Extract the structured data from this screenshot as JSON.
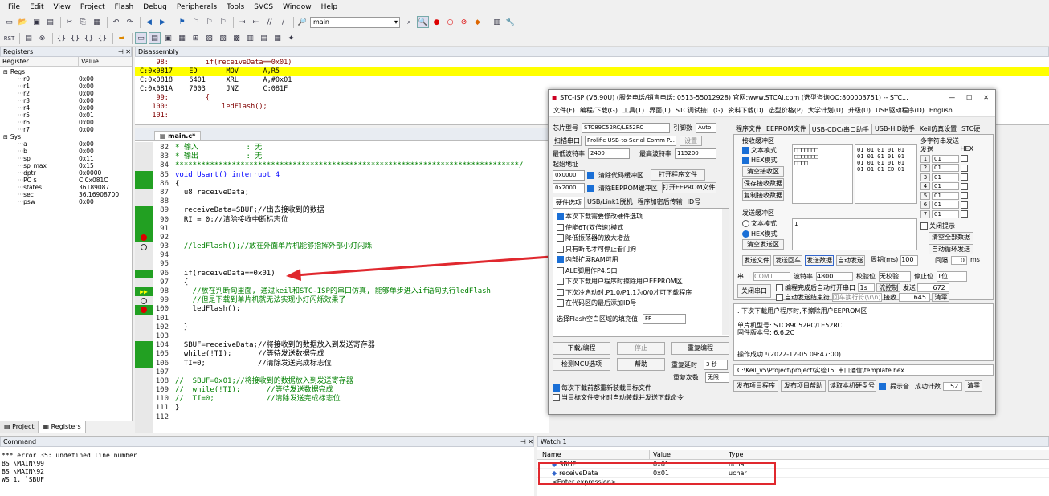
{
  "menu": [
    "File",
    "Edit",
    "View",
    "Project",
    "Flash",
    "Debug",
    "Peripherals",
    "Tools",
    "SVCS",
    "Window",
    "Help"
  ],
  "toolbar": {
    "target": "main"
  },
  "registers": {
    "title": "Registers",
    "col_register": "Register",
    "col_value": "Value",
    "rows": [
      {
        "name": "Regs",
        "value": "",
        "indent": 0
      },
      {
        "name": "r0",
        "value": "0x00",
        "indent": 1
      },
      {
        "name": "r1",
        "value": "0x00",
        "indent": 1
      },
      {
        "name": "r2",
        "value": "0x00",
        "indent": 1
      },
      {
        "name": "r3",
        "value": "0x00",
        "indent": 1
      },
      {
        "name": "r4",
        "value": "0x00",
        "indent": 1
      },
      {
        "name": "r5",
        "value": "0x01",
        "indent": 1
      },
      {
        "name": "r6",
        "value": "0x00",
        "indent": 1
      },
      {
        "name": "r7",
        "value": "0x00",
        "indent": 1
      },
      {
        "name": "Sys",
        "value": "",
        "indent": 0
      },
      {
        "name": "a",
        "value": "0x00",
        "indent": 1
      },
      {
        "name": "b",
        "value": "0x00",
        "indent": 1
      },
      {
        "name": "sp",
        "value": "0x11",
        "indent": 1
      },
      {
        "name": "sp_max",
        "value": "0x15",
        "indent": 1
      },
      {
        "name": "dptr",
        "value": "0x0000",
        "indent": 1
      },
      {
        "name": "PC  $",
        "value": "C:0x081C",
        "indent": 1
      },
      {
        "name": "states",
        "value": "36189087",
        "indent": 1
      },
      {
        "name": "sec",
        "value": "36.16908700",
        "indent": 1
      },
      {
        "name": "psw",
        "value": "0x00",
        "indent": 1
      }
    ],
    "tabs": [
      "Project",
      "Registers"
    ]
  },
  "disassembly": {
    "title": "Disassembly",
    "lines": [
      {
        "text": "    98:         if(receiveData==0x01)",
        "hl": false
      },
      {
        "text": "C:0x0817    ED       MOV      A,R5",
        "hl": true
      },
      {
        "text": "C:0x0818    6401     XRL      A,#0x01",
        "hl": false
      },
      {
        "text": "C:0x081A    7003     JNZ      C:081F",
        "hl": false
      },
      {
        "text": "    99:         {",
        "hl": false
      },
      {
        "text": "   100:             ledFlash();",
        "hl": false
      },
      {
        "text": "   101:",
        "hl": false
      }
    ]
  },
  "editor": {
    "tab": "main.c*",
    "lines": [
      {
        "n": "82",
        "t": "* 输入           : 无",
        "c": "cm"
      },
      {
        "n": "83",
        "t": "* 输出           : 无",
        "c": "cm"
      },
      {
        "n": "84",
        "t": "*******************************************************************************/",
        "c": "cm"
      },
      {
        "n": "85",
        "t": "void Usart() interrupt 4",
        "c": "kw"
      },
      {
        "n": "86",
        "t": "{",
        "c": ""
      },
      {
        "n": "87",
        "t": "  u8 receiveData;",
        "c": ""
      },
      {
        "n": "88",
        "t": "",
        "c": ""
      },
      {
        "n": "89",
        "t": "  receiveData=SBUF;//出去接收到的数据",
        "c": "mix"
      },
      {
        "n": "90",
        "t": "  RI = 0;//清除接收中断标志位",
        "c": "mix"
      },
      {
        "n": "91",
        "t": "",
        "c": ""
      },
      {
        "n": "92",
        "t": "",
        "c": ""
      },
      {
        "n": "93",
        "t": "  //ledFlash();//放在外面单片机能够指挥外部小灯闪烁",
        "c": "cm"
      },
      {
        "n": "94",
        "t": "",
        "c": ""
      },
      {
        "n": "95",
        "t": "",
        "c": ""
      },
      {
        "n": "96",
        "t": "  if(receiveData==0x01)",
        "c": ""
      },
      {
        "n": "97",
        "t": "  {",
        "c": ""
      },
      {
        "n": "98",
        "t": "    //放在判断句里面, 通过keil和STC-ISP的串口仿真, 能够单步进入if语句执行ledFlash",
        "c": "cm"
      },
      {
        "n": "99",
        "t": "    //但是下载到单片机就无法实现小灯闪烁效果了",
        "c": "cm"
      },
      {
        "n": "100",
        "t": "    ledFlash();",
        "c": ""
      },
      {
        "n": "101",
        "t": "",
        "c": ""
      },
      {
        "n": "102",
        "t": "  }",
        "c": ""
      },
      {
        "n": "103",
        "t": "",
        "c": ""
      },
      {
        "n": "104",
        "t": "  SBUF=receiveData;//将接收到的数据放入到发送寄存器",
        "c": "mix"
      },
      {
        "n": "105",
        "t": "  while(!TI);      //等待发送数据完成",
        "c": "mix"
      },
      {
        "n": "106",
        "t": "  TI=0;            //清除发送完成标志位",
        "c": "mix"
      },
      {
        "n": "107",
        "t": "",
        "c": ""
      },
      {
        "n": "108",
        "t": "//  SBUF=0x01;//将接收到的数据放入到发送寄存器",
        "c": "cm"
      },
      {
        "n": "109",
        "t": "//  while(!TI);      //等待发送数据完成",
        "c": "cm"
      },
      {
        "n": "110",
        "t": "//  TI=0;            //清除发送完成标志位",
        "c": "cm"
      },
      {
        "n": "111",
        "t": "}",
        "c": ""
      },
      {
        "n": "112",
        "t": "",
        "c": ""
      }
    ]
  },
  "command": {
    "title": "Command",
    "lines": [
      "*** error 35: undefined line number",
      "BS \\MAIN\\99",
      "BS \\MAIN\\92",
      "WS 1, `SBUF"
    ]
  },
  "watch": {
    "title": "Watch 1",
    "col_name": "Name",
    "col_value": "Value",
    "col_type": "Type",
    "rows": [
      {
        "name": "SBUF",
        "value": "0x01",
        "type": "uchar"
      },
      {
        "name": "receiveData",
        "value": "0x01",
        "type": "uchar"
      }
    ],
    "enter": "<Enter expression>"
  },
  "stc": {
    "title": "STC-ISP (V6.90U) (服务电话/销售电话: 0513-55012928) 官网:www.STCAI.com (选型咨询QQ:800003751) -- STC...",
    "menu": [
      "文件(F)",
      "编程/下载(G)",
      "工具(T)",
      "界面(L)",
      "STC调试接口(G)",
      "资料下载(D)",
      "选型价格(P)",
      "大学计划(U)",
      "升级(U)",
      "USB驱动程序(D)",
      "English"
    ],
    "chip_label": "芯片型号",
    "chip": "STC89C52RC/LE52RC",
    "pin_label": "引脚数",
    "pin": "Auto",
    "port_label": "扫描串口",
    "port": "Prolific USB-to-Serial Comm P...",
    "settings": "设置",
    "min_baud_label": "最低波特率",
    "min_baud": "2400",
    "max_baud_label": "最高波特率",
    "max_baud": "115200",
    "start_addr": "起始地址",
    "addr1": "0x0000",
    "clr_code": "清除代码缓冲区",
    "open_prog": "打开程序文件",
    "addr2": "0x2000",
    "clr_eeprom": "清除EEPROM缓冲区",
    "open_eeprom": "打开EEPROM文件",
    "hw_tabs": [
      "硬件选项",
      "USB/Link1脱机",
      "程序加密后传输",
      "ID号"
    ],
    "options": [
      {
        "t": "本次下载需要修改硬件选项",
        "on": true
      },
      {
        "t": "使能6T(双倍速)模式",
        "on": false
      },
      {
        "t": "降低振荡器的放大增益",
        "on": false
      },
      {
        "t": "只有断电才可停止看门狗",
        "on": false
      },
      {
        "t": "内部扩展RAM可用",
        "on": true
      },
      {
        "t": "ALE脚用作P4.5口",
        "on": false
      },
      {
        "t": "下次下载用户程序时擦除用户EEPROM区",
        "on": false
      },
      {
        "t": "下次冷启动时,P1.0/P1.1为0/0才可下载程序",
        "on": false
      },
      {
        "t": "在代码区的最后添加ID号",
        "on": false
      }
    ],
    "fill_label": "选择Flash空白区域的填充值",
    "fill": "FF",
    "download": "下载/编程",
    "stop": "停止",
    "reprogram": "重复编程",
    "check_mcu": "检测MCU选项",
    "help": "帮助",
    "repeat_delay_label": "重复延时",
    "repeat_delay": "3 秒",
    "repeat_count_label": "重复次数",
    "repeat_count": "无限",
    "reload1": "每次下载前都重新装载目标文件",
    "reload2": "当目标文件变化时自动装载并发送下载命令",
    "right_tabs": [
      "程序文件",
      "EEPROM文件",
      "USB-CDC/串口助手",
      "USB-HID助手",
      "Keil仿真设置",
      "STC硬"
    ],
    "recv_label": "接收缓冲区",
    "text_mode": "文本模式",
    "hex_mode": "HEX模式",
    "clear_recv": "清空接收区",
    "save_recv": "保存接收数据",
    "copy_recv": "复制接收数据",
    "recv_hex": "01 01 01 01 01\n01 01 01 01 01\n01 01 01 01 01\n01 01 01 CD 01",
    "send_label": "发送缓冲区",
    "send_text": "文本模式",
    "send_hex": "HEX模式",
    "clear_send": "清空发送区",
    "send_data": "1",
    "multi_label": "多字符串发送",
    "multi_send": "发送",
    "multi_hex": "HEX",
    "multi_rows": [
      {
        "n": "1",
        "v": "01"
      },
      {
        "n": "2",
        "v": "01"
      },
      {
        "n": "3",
        "v": "01"
      },
      {
        "n": "4",
        "v": "01"
      },
      {
        "n": "5",
        "v": "01"
      },
      {
        "n": "6",
        "v": "01"
      },
      {
        "n": "7",
        "v": "01"
      }
    ],
    "close_hint": "关闭提示",
    "clear_all": "清空全部数据",
    "auto_loop": "自动循环发送",
    "interval_label": "间隔",
    "interval": "0",
    "ms": "ms",
    "send_file": "发送文件",
    "send_enter": "发送回车",
    "send_btn": "发送数据",
    "auto_send": "自动发送",
    "period": "周期(ms)",
    "period_val": "100",
    "com_label": "串口",
    "com": "COM1",
    "baud_label": "波特率",
    "baud": "4800",
    "parity_label": "校验位",
    "parity": "无校验",
    "stop_label": "停止位",
    "stopbits": "1位",
    "close_port": "关闭串口",
    "auto_open": "编程完成后自动打开串口",
    "auto_open_val": "1s",
    "flow": "流控制",
    "send_count_label": "发送",
    "send_count": "672",
    "auto_send2": "自动发送结束符",
    "endchar": "回车换行符(\\r\\n)",
    "recv_count_label": "接收",
    "recv_count": "645",
    "clear_count": "清零",
    "log": ". 下次下载用户程序时,不擦除用户EEPROM区\n\n单片机型号: STC89C52RC/LE52RC\n固件版本号: 6.6.2C\n\n\n操作成功 !(2022-12-05 09:47:00)",
    "path": "C:\\Keil_v5\\Project\\project\\实验15: 串口通信\\template.hex",
    "publish_prog": "发布项目程序",
    "publish_help": "发布项目帮助",
    "read_disk": "读取本机硬盘号",
    "tips": "提示音",
    "success_label": "成功计数",
    "success": "52",
    "clear2": "清零"
  }
}
